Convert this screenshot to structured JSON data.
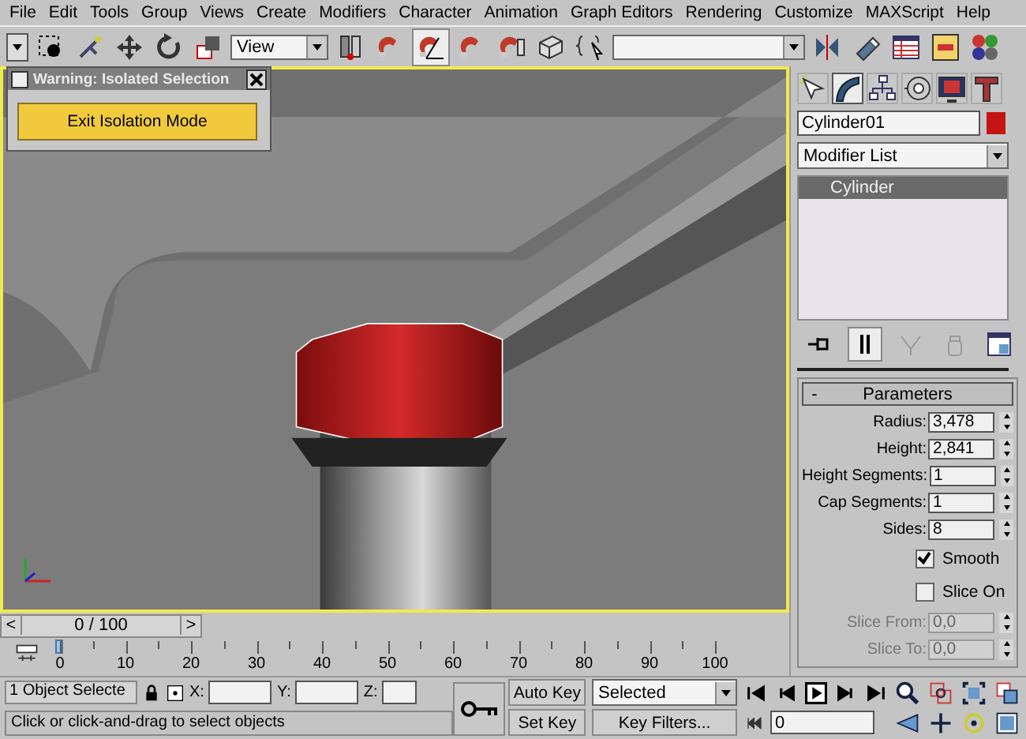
{
  "menu": [
    "File",
    "Edit",
    "Tools",
    "Group",
    "Views",
    "Create",
    "Modifiers",
    "Character",
    "Animation",
    "Graph Editors",
    "Rendering",
    "Customize",
    "MAXScript",
    "Help"
  ],
  "toolbar": {
    "reference_dropdown": "View"
  },
  "isolation_dialog": {
    "title": "Warning: Isolated Selection",
    "button": "Exit Isolation Mode"
  },
  "viewport": {
    "active": true
  },
  "command_panel": {
    "tabs": [
      {
        "selected": false
      },
      {
        "selected": true
      },
      {
        "selected": false
      },
      {
        "selected": false
      },
      {
        "selected": false
      },
      {
        "selected": false
      }
    ],
    "object_name": "Cylinder01",
    "modifier_list": "Modifier List",
    "stack": [
      {
        "label": "Cylinder",
        "selected": true
      }
    ],
    "rollout": {
      "toggle": "-",
      "title": "Parameters"
    },
    "params": [
      {
        "kind": "spinner",
        "label": "Radius:",
        "value": "3,478",
        "disabled": false
      },
      {
        "kind": "spinner",
        "label": "Height:",
        "value": "2,841",
        "disabled": false
      },
      {
        "kind": "spinner",
        "label": "Height Segments:",
        "value": "1",
        "disabled": false
      },
      {
        "kind": "spinner",
        "label": "Cap Segments:",
        "value": "1",
        "disabled": false
      },
      {
        "kind": "spinner",
        "label": "Sides:",
        "value": "8",
        "disabled": false
      },
      {
        "kind": "checkbox",
        "label": "Smooth",
        "checked": true
      },
      {
        "kind": "checkbox",
        "label": "Slice On",
        "checked": false
      },
      {
        "kind": "spinner",
        "label": "Slice From:",
        "value": "0,0",
        "disabled": true
      },
      {
        "kind": "spinner",
        "label": "Slice To:",
        "value": "0,0",
        "disabled": true
      }
    ]
  },
  "time_slider": {
    "prev": "<",
    "label": "0 / 100",
    "next": ">",
    "level": 0
  },
  "ruler": [
    "0",
    "10",
    "20",
    "30",
    "40",
    "50",
    "60",
    "70",
    "80",
    "90",
    "100"
  ],
  "status": {
    "selection": "1 Object Selecte",
    "x_label": "X:",
    "y_label": "Y:",
    "z_label": "Z:",
    "prompt": "Click or click-and-drag to select objects"
  },
  "animation": {
    "auto_key": "Auto Key",
    "set_key": "Set Key",
    "key_mode": "Selected",
    "key_filters": "Key Filters...",
    "frame": "0"
  }
}
